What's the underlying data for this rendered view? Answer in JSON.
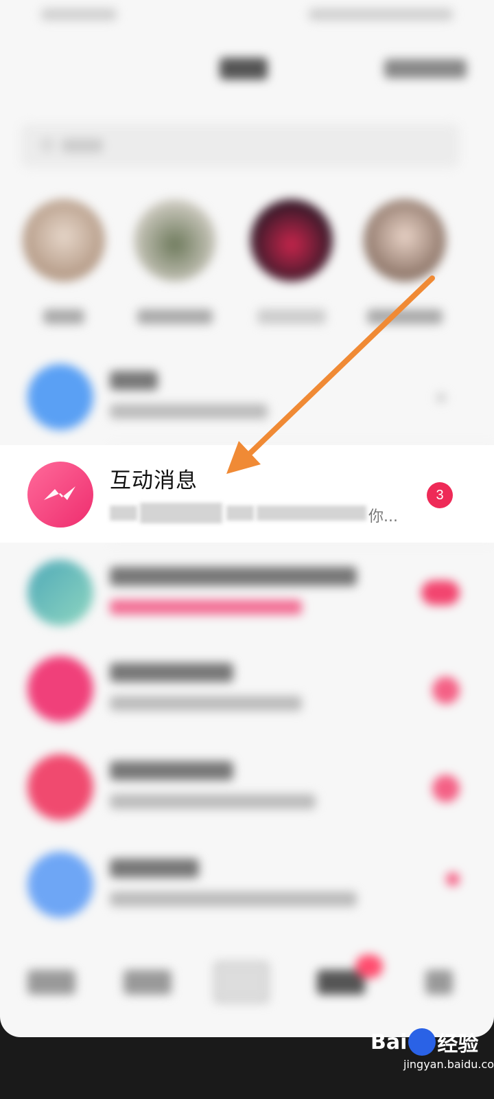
{
  "highlighted_item": {
    "title": "互动消息",
    "preview_end": "你...",
    "badge_count": "3"
  },
  "watermark": {
    "text_before": "Bai",
    "text_after": "经验",
    "url": "jingyan.baidu.com"
  },
  "colors": {
    "accent_pink": "#ee2d6e",
    "badge_red": "#ee2a57",
    "arrow_orange": "#f08a35"
  }
}
